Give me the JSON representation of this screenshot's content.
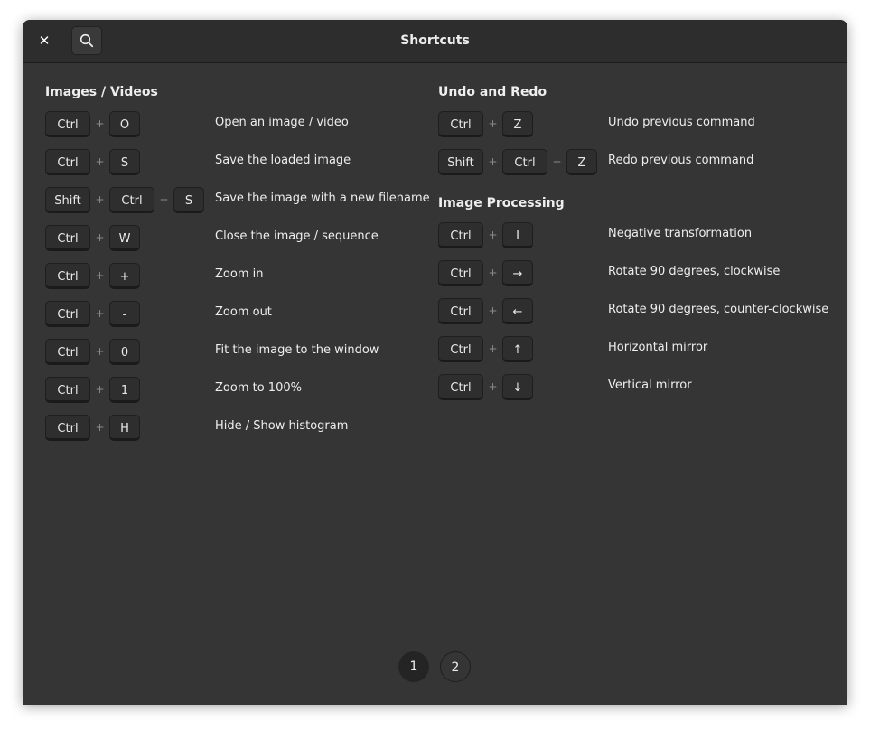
{
  "header": {
    "title": "Shortcuts",
    "close_glyph": "✕",
    "search_icon": "search-icon"
  },
  "plus": "+",
  "left_section": {
    "title": "Images / Videos",
    "rows": [
      {
        "keys": [
          "Ctrl",
          "O"
        ],
        "desc": "Open an image / video"
      },
      {
        "keys": [
          "Ctrl",
          "S"
        ],
        "desc": "Save the loaded image"
      },
      {
        "keys": [
          "Shift",
          "Ctrl",
          "S"
        ],
        "desc": "Save the image with a new filename"
      },
      {
        "keys": [
          "Ctrl",
          "W"
        ],
        "desc": "Close the image / sequence"
      },
      {
        "keys": [
          "Ctrl",
          "+"
        ],
        "desc": "Zoom in"
      },
      {
        "keys": [
          "Ctrl",
          "-"
        ],
        "desc": "Zoom out"
      },
      {
        "keys": [
          "Ctrl",
          "0"
        ],
        "desc": "Fit the image to the window"
      },
      {
        "keys": [
          "Ctrl",
          "1"
        ],
        "desc": "Zoom to 100%"
      },
      {
        "keys": [
          "Ctrl",
          "H"
        ],
        "desc": "Hide / Show histogram"
      }
    ]
  },
  "undo_section": {
    "title": "Undo and Redo",
    "rows": [
      {
        "keys": [
          "Ctrl",
          "Z"
        ],
        "desc": "Undo previous command"
      },
      {
        "keys": [
          "Shift",
          "Ctrl",
          "Z"
        ],
        "desc": "Redo previous command"
      }
    ]
  },
  "processing_section": {
    "title": "Image Processing",
    "rows": [
      {
        "keys": [
          "Ctrl",
          "I"
        ],
        "desc": "Negative transformation"
      },
      {
        "keys": [
          "Ctrl",
          "→"
        ],
        "desc": "Rotate 90 degrees, clockwise"
      },
      {
        "keys": [
          "Ctrl",
          "←"
        ],
        "desc": "Rotate 90 degrees, counter-clockwise"
      },
      {
        "keys": [
          "Ctrl",
          "↑"
        ],
        "desc": "Horizontal mirror"
      },
      {
        "keys": [
          "Ctrl",
          "↓"
        ],
        "desc": "Vertical mirror"
      }
    ]
  },
  "pagination": {
    "pages": [
      "1",
      "2"
    ],
    "current": "1"
  }
}
